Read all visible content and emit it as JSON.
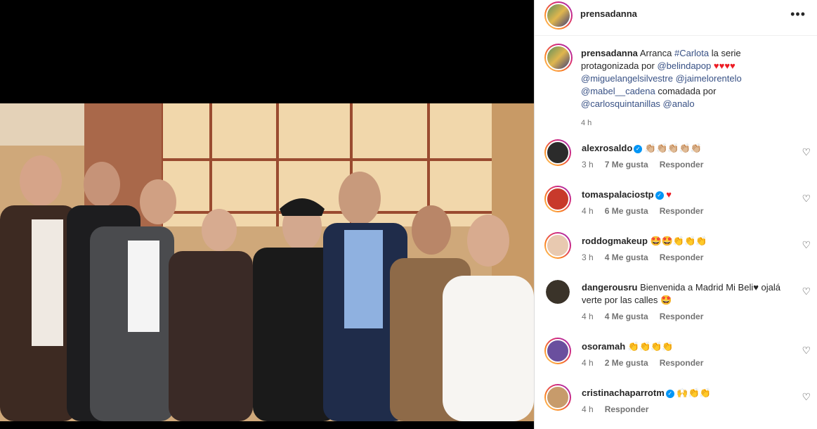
{
  "post": {
    "username": "prensadanna",
    "more_label": "•••"
  },
  "caption": {
    "username": "prensadanna",
    "text1": "Arranca",
    "hashtag": "#Carlota",
    "text2": "la serie protagonizada por",
    "mention1": "@belindapop",
    "hearts": "♥♥♥♥",
    "mention2": "@miguelangelsilvestre",
    "mention3": "@jaimelorentelo",
    "mention4": "@mabel__cadena",
    "text3": "comadada por",
    "mention5": "@carlosquintanillas",
    "mention6": "@analo",
    "time": "4 h"
  },
  "comments": [
    {
      "username": "alexrosaldo",
      "verified": true,
      "text": "👏🏼👏🏼👏🏼👏🏼👏🏼",
      "time": "3 h",
      "likes": "7 Me gusta",
      "reply": "Responder",
      "avatar_color": "#2b2b2b"
    },
    {
      "username": "tomaspalaciostp",
      "verified": true,
      "text": "♥",
      "time": "4 h",
      "likes": "6 Me gusta",
      "reply": "Responder",
      "avatar_color": "#c8392b"
    },
    {
      "username": "roddogmakeup",
      "verified": false,
      "text": "🤩🤩👏👏👏",
      "time": "3 h",
      "likes": "4 Me gusta",
      "reply": "Responder",
      "avatar_color": "#e8c9b0"
    },
    {
      "username": "dangerousru",
      "verified": false,
      "text": "Bienvenida a Madrid Mi Beli♥ ojalá verte por las calles 🤩",
      "time": "4 h",
      "likes": "4 Me gusta",
      "reply": "Responder",
      "avatar_color": "#3a3329"
    },
    {
      "username": "osoramah",
      "verified": false,
      "text": "👏👏👏👏",
      "time": "4 h",
      "likes": "2 Me gusta",
      "reply": "Responder",
      "avatar_color": "#6a4f9e"
    },
    {
      "username": "cristinachaparrotm",
      "verified": true,
      "text": "🙌👏👏",
      "time": "4 h",
      "likes": "",
      "reply": "Responder",
      "avatar_color": "#c79b6b"
    }
  ],
  "icons": {
    "like": "heart-outline-icon",
    "more": "more-horizontal-icon",
    "verified": "verified-badge-icon"
  },
  "colors": {
    "link": "#385185",
    "heart": "#ed1c24",
    "verified": "#0095f6",
    "muted": "#737373"
  }
}
